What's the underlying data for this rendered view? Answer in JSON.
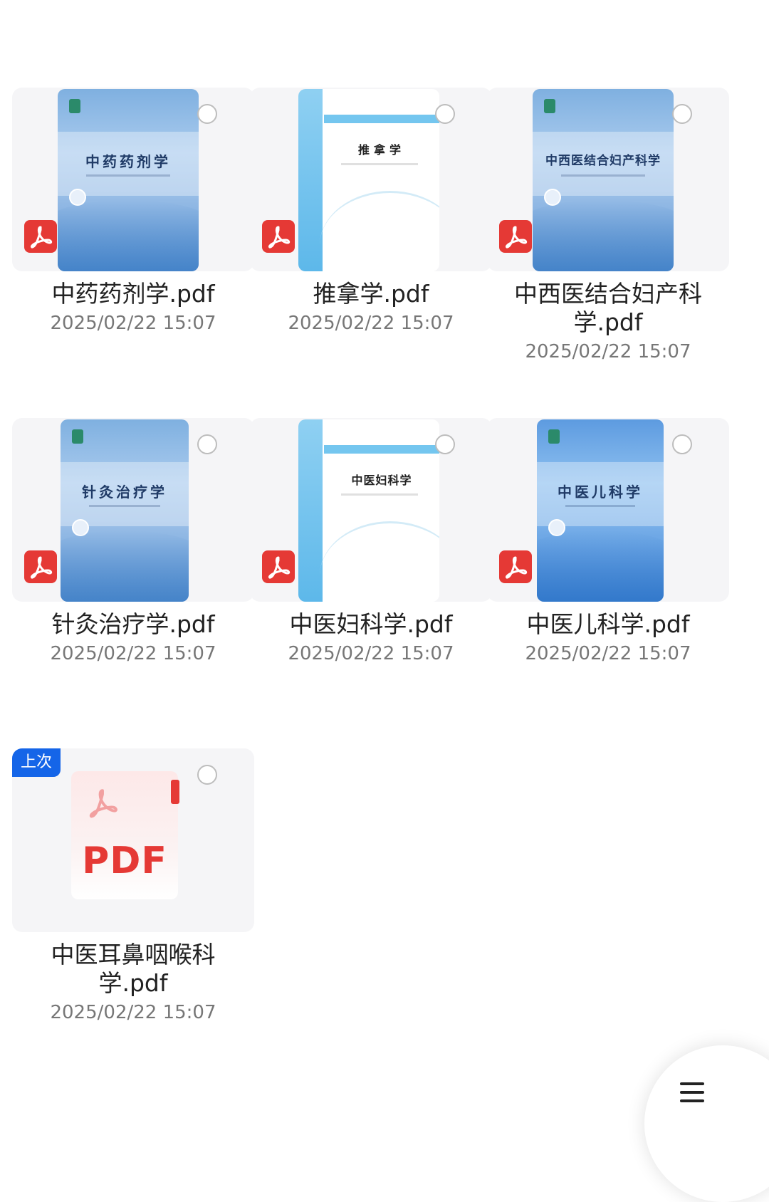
{
  "files": [
    {
      "name": "中药药剂学.pdf",
      "date": "2025/02/22 15:07",
      "cover_title": "中药药剂学",
      "cover": "blue",
      "thumb_icon": "pdf-icon"
    },
    {
      "name": "推拿学.pdf",
      "date": "2025/02/22 15:07",
      "cover_title": "推拿学",
      "cover": "white",
      "thumb_icon": "pdf-icon"
    },
    {
      "name": "中西医结合妇产科学.pdf",
      "date": "2025/02/22 15:07",
      "cover_title": "中西医结合妇产科学",
      "cover": "blue",
      "thumb_icon": "pdf-icon"
    },
    {
      "name": "针灸治疗学.pdf",
      "date": "2025/02/22 15:07",
      "cover_title": "针灸治疗学",
      "cover": "blue",
      "thumb_icon": "pdf-icon"
    },
    {
      "name": "中医妇科学.pdf",
      "date": "2025/02/22 15:07",
      "cover_title": "中医妇科学",
      "cover": "white",
      "thumb_icon": "pdf-icon"
    },
    {
      "name": "中医儿科学.pdf",
      "date": "2025/02/22 15:07",
      "cover_title": "中医儿科学",
      "cover": "blue-deep",
      "thumb_icon": "pdf-icon"
    },
    {
      "name": "中医耳鼻咽喉科学.pdf",
      "date": "2025/02/22 15:07",
      "badge": "上次",
      "generic_label": "PDF",
      "thumb_icon": "pdf-icon"
    }
  ],
  "menu_button": {
    "icon": "menu-icon"
  },
  "colors": {
    "pdf_red": "#e53935",
    "badge_blue": "#1565e8",
    "date_gray": "#777777"
  }
}
